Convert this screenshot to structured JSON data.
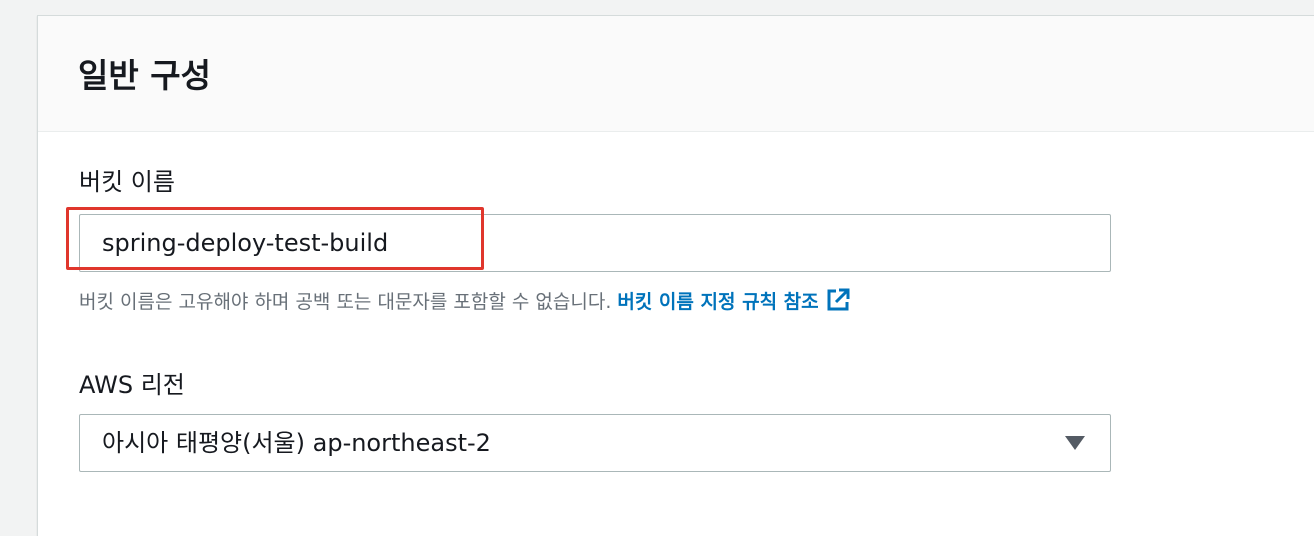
{
  "section": {
    "title": "일반 구성"
  },
  "bucket_name": {
    "label": "버킷 이름",
    "value": "spring-deploy-test-build",
    "hint": "버킷 이름은 고유해야 하며 공백 또는 대문자를 포함할 수 없습니다.",
    "link_label": "버킷 이름 지정 규칙 참조",
    "link_icon": "external-link-icon"
  },
  "region": {
    "label": "AWS 리전",
    "selected": "아시아 태평양(서울) ap-northeast-2",
    "caret_icon": "caret-down-icon"
  },
  "colors": {
    "link": "#0073bb",
    "highlight": "#e0362c",
    "text": "#16191f",
    "hint": "#687078"
  }
}
